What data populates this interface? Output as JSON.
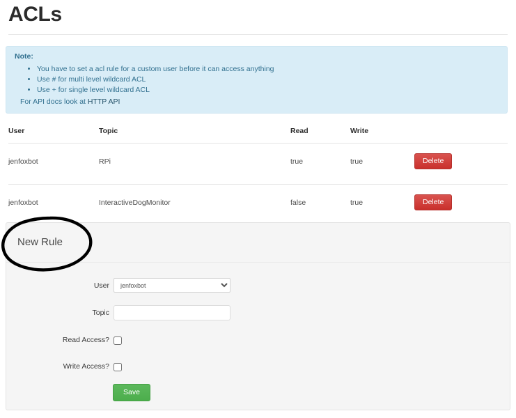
{
  "page": {
    "title": "ACLs"
  },
  "note": {
    "heading": "Note:",
    "items": [
      "You have to set a acl rule for a custom user before it can access anything",
      "Use # for multi level wildcard ACL",
      "Use + for single level wildcard ACL"
    ],
    "footer_prefix": "For API docs look at ",
    "footer_link": "HTTP API",
    "background_color": "#d9edf7",
    "text_color": "#31708f"
  },
  "table": {
    "columns": [
      "User",
      "Topic",
      "Read",
      "Write",
      ""
    ],
    "rows": [
      {
        "user": "jenfoxbot",
        "topic": "RPi",
        "read": "true",
        "write": "true",
        "action_label": "Delete"
      },
      {
        "user": "jenfoxbot",
        "topic": "InteractiveDogMonitor",
        "read": "false",
        "write": "true",
        "action_label": "Delete"
      }
    ],
    "delete_color": "#d9534f"
  },
  "new_rule": {
    "panel_title": "New Rule",
    "fields": {
      "user_label": "User",
      "user_value": "jenfoxbot",
      "user_options": [
        "jenfoxbot"
      ],
      "topic_label": "Topic",
      "topic_value": "",
      "topic_placeholder": "",
      "read_label": "Read Access?",
      "read_checked": false,
      "write_label": "Write Access?",
      "write_checked": false
    },
    "save_label": "Save",
    "save_color": "#5cb85c"
  },
  "annotation": {
    "shape": "hand-drawn-ellipse",
    "target": "New Rule",
    "color": "#000000"
  }
}
